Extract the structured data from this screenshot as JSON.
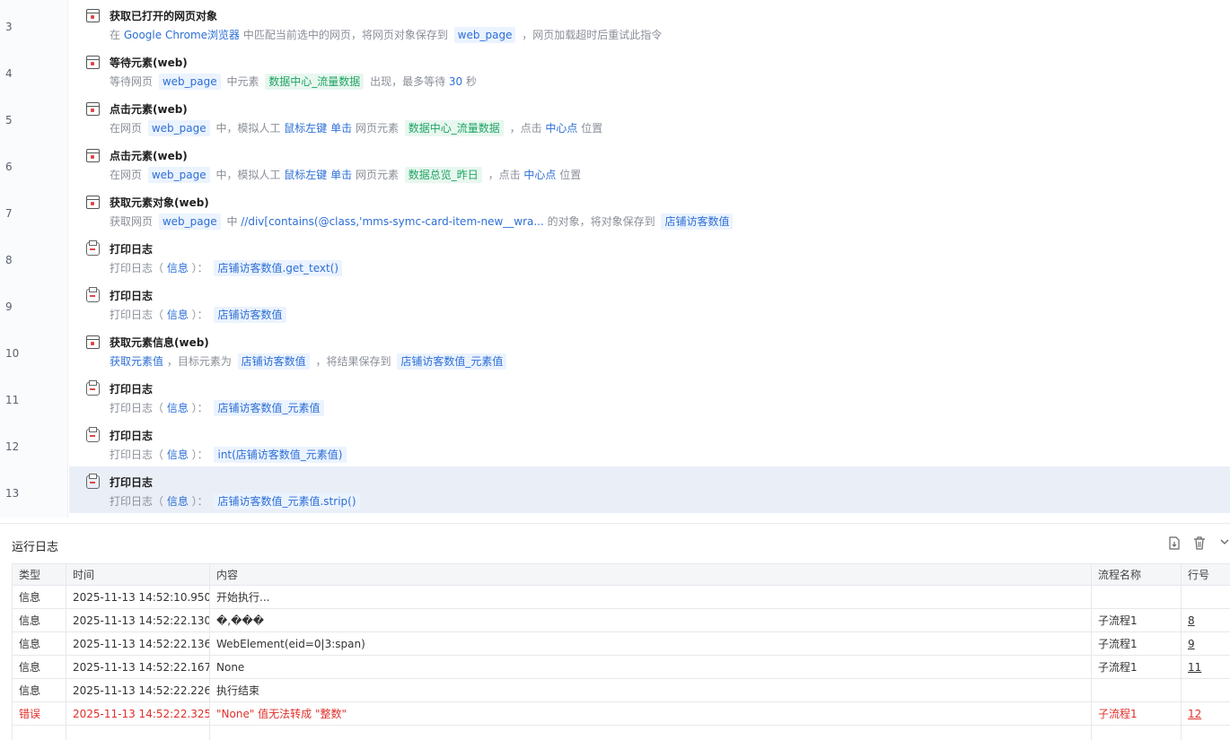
{
  "steps": [
    {
      "no": "3",
      "icon": "browser-window-icon",
      "title": "获取已打开的网页对象",
      "desc": [
        [
          "t",
          "在 "
        ],
        [
          "kw",
          "Google Chrome浏览器"
        ],
        [
          "t",
          " 中匹配当前选中的网页，将网页对象保存到 "
        ],
        [
          "chip",
          "web_page"
        ],
        [
          "t",
          " ，网页加载超时后重试此指令"
        ]
      ]
    },
    {
      "no": "4",
      "icon": "wait-element-icon",
      "title": "等待元素(web)",
      "desc": [
        [
          "t",
          "等待网页 "
        ],
        [
          "chip",
          "web_page"
        ],
        [
          "t",
          " 中元素 "
        ],
        [
          "chipg",
          "数据中心_流量数据"
        ],
        [
          "t",
          " 出现，最多等待 "
        ],
        [
          "kw",
          "30"
        ],
        [
          "t",
          " 秒"
        ]
      ]
    },
    {
      "no": "5",
      "icon": "click-element-icon",
      "title": "点击元素(web)",
      "desc": [
        [
          "t",
          "在网页 "
        ],
        [
          "chip",
          "web_page"
        ],
        [
          "t",
          " 中，模拟人工 "
        ],
        [
          "kw",
          "鼠标左键"
        ],
        [
          "t",
          " "
        ],
        [
          "kw",
          "单击"
        ],
        [
          "t",
          " 网页元素 "
        ],
        [
          "chipg",
          "数据中心_流量数据"
        ],
        [
          "t",
          " ，点击 "
        ],
        [
          "kw",
          "中心点"
        ],
        [
          "t",
          " 位置"
        ]
      ]
    },
    {
      "no": "6",
      "icon": "click-element-icon",
      "title": "点击元素(web)",
      "desc": [
        [
          "t",
          "在网页 "
        ],
        [
          "chip",
          "web_page"
        ],
        [
          "t",
          " 中，模拟人工 "
        ],
        [
          "kw",
          "鼠标左键"
        ],
        [
          "t",
          " "
        ],
        [
          "kw",
          "单击"
        ],
        [
          "t",
          " 网页元素 "
        ],
        [
          "chipg",
          "数据总览_昨日"
        ],
        [
          "t",
          " ，点击 "
        ],
        [
          "kw",
          "中心点"
        ],
        [
          "t",
          " 位置"
        ]
      ]
    },
    {
      "no": "7",
      "icon": "element-object-icon",
      "title": "获取元素对象(web)",
      "desc": [
        [
          "t",
          "获取网页 "
        ],
        [
          "chip",
          "web_page"
        ],
        [
          "t",
          " 中 "
        ],
        [
          "kw",
          "//div[contains(@class,'mms-symc-card-item-new__wra..."
        ],
        [
          "t",
          " 的对象，将对象保存到 "
        ],
        [
          "chip",
          "店铺访客数值"
        ]
      ]
    },
    {
      "no": "8",
      "icon": "print-log-icon",
      "title": "打印日志",
      "desc": [
        [
          "t",
          "打印日志（ "
        ],
        [
          "kw",
          "信息"
        ],
        [
          "t",
          " ）： "
        ],
        [
          "chip",
          "店铺访客数值.get_text()"
        ]
      ]
    },
    {
      "no": "9",
      "icon": "print-log-icon",
      "title": "打印日志",
      "desc": [
        [
          "t",
          "打印日志（ "
        ],
        [
          "kw",
          "信息"
        ],
        [
          "t",
          " ）： "
        ],
        [
          "chip",
          "店铺访客数值"
        ]
      ]
    },
    {
      "no": "10",
      "icon": "element-info-icon",
      "title": "获取元素信息(web)",
      "desc": [
        [
          "kw",
          "获取元素值"
        ],
        [
          "t",
          " ，目标元素为 "
        ],
        [
          "chip",
          "店铺访客数值"
        ],
        [
          "t",
          " ，将结果保存到 "
        ],
        [
          "chip",
          "店铺访客数值_元素值"
        ]
      ]
    },
    {
      "no": "11",
      "icon": "print-log-icon",
      "title": "打印日志",
      "desc": [
        [
          "t",
          "打印日志（ "
        ],
        [
          "kw",
          "信息"
        ],
        [
          "t",
          " ）： "
        ],
        [
          "chip",
          "店铺访客数值_元素值"
        ]
      ]
    },
    {
      "no": "12",
      "icon": "print-log-icon",
      "title": "打印日志",
      "desc": [
        [
          "t",
          "打印日志（ "
        ],
        [
          "kw",
          "信息"
        ],
        [
          "t",
          " ）： "
        ],
        [
          "chip",
          "int(店铺访客数值_元素值)"
        ]
      ]
    },
    {
      "no": "13",
      "icon": "print-log-icon",
      "title": "打印日志",
      "selected": true,
      "desc": [
        [
          "t",
          "打印日志（ "
        ],
        [
          "kw",
          "信息"
        ],
        [
          "t",
          " ）： "
        ],
        [
          "chip",
          "店铺访客数值_元素值.strip()"
        ]
      ]
    }
  ],
  "runlog": {
    "title": "运行日志",
    "tools": {
      "export": "export-icon",
      "clear": "trash-icon",
      "collapse": "chevron-down-icon"
    },
    "columns": [
      "类型",
      "时间",
      "内容",
      "流程名称",
      "行号"
    ],
    "rows": [
      {
        "type": "信息",
        "time": "2025-11-13 14:52:10.950",
        "content": "开始执行...",
        "flow": "",
        "line": ""
      },
      {
        "type": "信息",
        "time": "2025-11-13 14:52:22.130",
        "content": "�,���",
        "flow": "子流程1",
        "line": "8"
      },
      {
        "type": "信息",
        "time": "2025-11-13 14:52:22.136",
        "content": "WebElement(eid=0|3:span)",
        "flow": "子流程1",
        "line": "9"
      },
      {
        "type": "信息",
        "time": "2025-11-13 14:52:22.167",
        "content": "None",
        "flow": "子流程1",
        "line": "11"
      },
      {
        "type": "信息",
        "time": "2025-11-13 14:52:22.226",
        "content": "执行结束",
        "flow": "",
        "line": ""
      },
      {
        "type": "错误",
        "time": "2025-11-13 14:52:22.325",
        "content": "\"None\" 值无法转成 \"整数\"",
        "flow": "子流程1",
        "line": "12",
        "error": true
      }
    ]
  },
  "colors": {
    "keyword": "#2d6fd6",
    "chip_bg": "#ebf3fe",
    "chip_green": "#1fa464",
    "error": "#e0302b",
    "selected_bg": "#eaeff7"
  }
}
